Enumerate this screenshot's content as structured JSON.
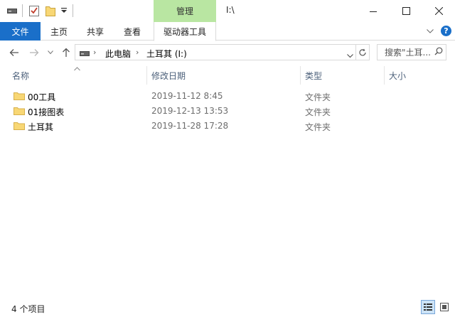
{
  "title_bar": {
    "context_tab": "管理",
    "path": "I:\\"
  },
  "ribbon": {
    "tabs": [
      "文件",
      "主页",
      "共享",
      "查看",
      "驱动器工具"
    ]
  },
  "address": {
    "crumbs": [
      "此电脑",
      "土耳其 (I:)"
    ]
  },
  "search": {
    "placeholder": "搜索\"土耳..."
  },
  "columns": [
    "名称",
    "修改日期",
    "类型",
    "大小"
  ],
  "files": [
    {
      "name": "00工具",
      "date": "2019-11-12 8:45",
      "type": "文件夹"
    },
    {
      "name": "01接图表",
      "date": "2019-12-13 13:53",
      "type": "文件夹"
    },
    {
      "name": "土耳其",
      "date": "2019-11-28 17:28",
      "type": "文件夹"
    }
  ],
  "status": {
    "count_text": "4 个项目"
  },
  "colors": {
    "file_tab": "#1a6fc9",
    "manage_tab": "#b9e6a2",
    "folder": "#f8d775"
  }
}
